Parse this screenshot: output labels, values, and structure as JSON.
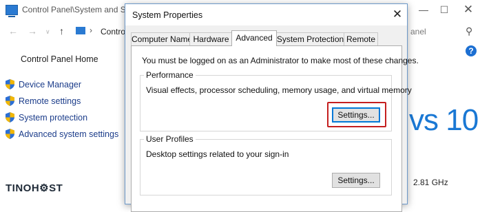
{
  "background_window": {
    "title": "Control Panel\\System and Se",
    "address_text": "Contro",
    "search_placeholder": "anel",
    "sidebar": {
      "home": "Control Panel Home",
      "links": [
        {
          "label": "Device Manager"
        },
        {
          "label": "Remote settings"
        },
        {
          "label": "System protection"
        },
        {
          "label": "Advanced system settings"
        }
      ]
    },
    "windows_logo_text": "vs 10",
    "cpu_speed": "2.81 GHz"
  },
  "dialog": {
    "title": "System Properties",
    "tabs": [
      {
        "label": "Computer Name"
      },
      {
        "label": "Hardware"
      },
      {
        "label": "Advanced"
      },
      {
        "label": "System Protection"
      },
      {
        "label": "Remote"
      }
    ],
    "active_tab": "Advanced",
    "admin_note": "You must be logged on as an Administrator to make most of these changes.",
    "performance": {
      "label": "Performance",
      "description": "Visual effects, processor scheduling, memory usage, and virtual memory",
      "button": "Settings..."
    },
    "user_profiles": {
      "label": "User Profiles",
      "description": "Desktop settings related to your sign-in",
      "button": "Settings..."
    }
  },
  "watermark": "TINOH⚙ST",
  "colors": {
    "accent_blue": "#1a78d4",
    "highlight_red": "#c41e1e",
    "focus_blue": "#0078d7",
    "shield_blue": "#2b6fd6",
    "shield_gold": "#f2b705"
  }
}
